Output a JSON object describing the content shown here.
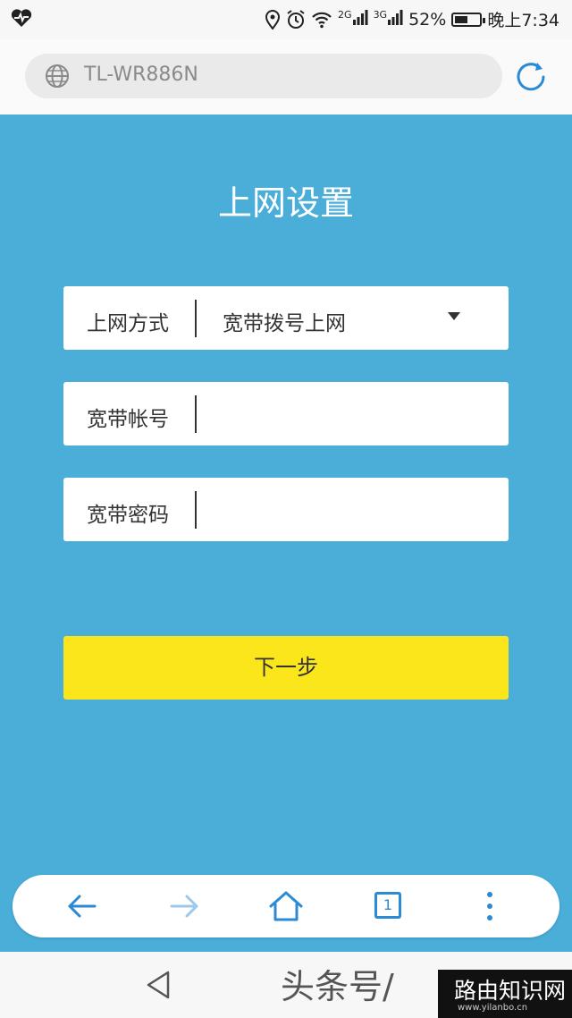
{
  "status_bar": {
    "net_2g": "2G",
    "net_3g": "3G",
    "battery_percent": "52%",
    "battery_level": 0.52,
    "time": "晚上7:34"
  },
  "browser": {
    "url": "TL-WR886N"
  },
  "page": {
    "title": "上网设置",
    "fields": [
      {
        "label": "上网方式",
        "value": "宽带拨号上网"
      },
      {
        "label": "宽带帐号",
        "value": ""
      },
      {
        "label": "宽带密码",
        "value": ""
      }
    ],
    "next_button": "下一步"
  },
  "nav": {
    "tabs_count": "1"
  },
  "watermark": {
    "source": "头条号/",
    "site_name": "路由知识网",
    "site_url": "www.yilanbo.cn"
  },
  "colors": {
    "background": "#4aaed8",
    "button": "#fbe61b",
    "accent": "#2a8ad4"
  },
  "icons": {
    "status": [
      "heartbeat-icon",
      "location-icon",
      "alarm-icon",
      "wifi-icon",
      "signal-icon",
      "battery-icon"
    ],
    "browser": [
      "globe-icon",
      "reload-icon"
    ],
    "nav": [
      "back-arrow-icon",
      "forward-arrow-icon",
      "home-icon",
      "tabs-icon",
      "more-icon"
    ],
    "system": [
      "system-back-icon"
    ]
  }
}
